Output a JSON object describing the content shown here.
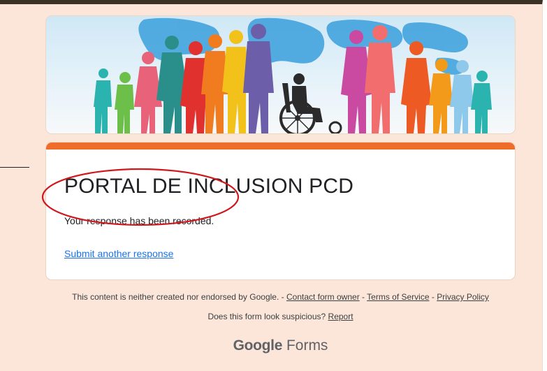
{
  "form": {
    "title": "PORTAL DE INCLUSION PCD",
    "confirmation": "Your response has been recorded.",
    "submit_another": "Submit another response"
  },
  "footer": {
    "disclaimer": "This content is neither created nor endorsed by Google.",
    "separator": " - ",
    "contact_owner": "Contact form owner",
    "terms": "Terms of Service",
    "privacy": "Privacy Policy",
    "suspicious": "Does this form look suspicious?",
    "report": "Report"
  },
  "brand": {
    "google": "Google",
    "forms": "Forms"
  },
  "colors": {
    "page_background": "#fce6d9",
    "accent": "#ee6d2b",
    "link": "#1a73e8",
    "annotation": "#d0171c"
  },
  "header_image": {
    "icon": "people-silhouettes-wheelchair-banner"
  }
}
